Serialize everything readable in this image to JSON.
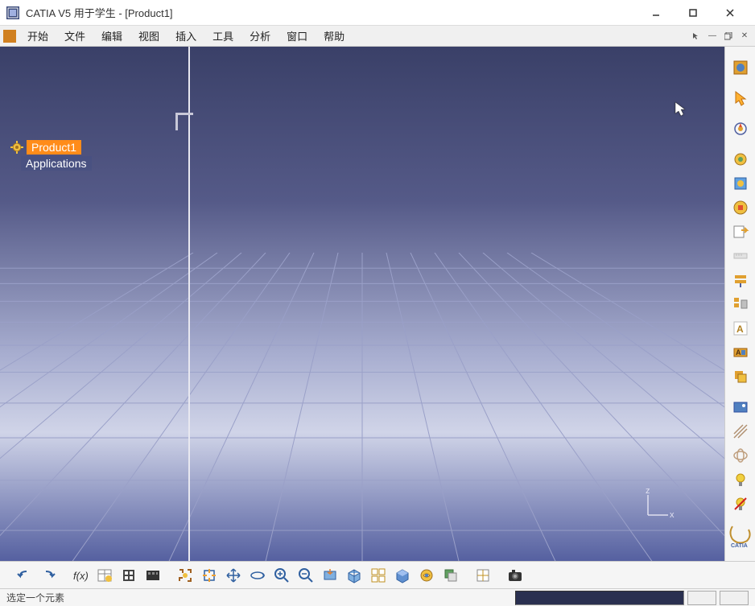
{
  "titlebar": {
    "title": "CATIA V5 用于学生 - [Product1]"
  },
  "menus": {
    "start": "开始",
    "file": "文件",
    "edit": "编辑",
    "view": "视图",
    "insert": "插入",
    "tools": "工具",
    "analyze": "分析",
    "window": "窗口",
    "help": "帮助"
  },
  "tree": {
    "product": "Product1",
    "applications": "Applications"
  },
  "axis": {
    "x": "x",
    "z": "z"
  },
  "status": {
    "prompt": "选定一个元素"
  },
  "right_tools": [
    "workbench-icon",
    "select-arrow-icon",
    "compass-icon",
    "knowledge-icon",
    "properties-icon",
    "feature-icon",
    "export-icon",
    "measure-icon",
    "flatten-icon",
    "tree-icon",
    "text-icon",
    "advanced-icon",
    "stack-icon",
    "render-icon",
    "hatch-icon",
    "view-wire-icon",
    "light-icon",
    "no-light-icon"
  ],
  "bottom_tools": [
    "undo-icon",
    "redo-icon",
    "formula-icon",
    "design-table-icon",
    "knowledge-advisor-icon",
    "scenes-icon",
    "capture-icon",
    "fit-icon",
    "pan-icon",
    "rotate-icon",
    "zoom-in-icon",
    "zoom-out-icon",
    "normal-view-icon",
    "iso-view-icon",
    "multi-view-icon",
    "shading-icon",
    "hide-show-icon",
    "swap-visible-icon",
    "coord-icon",
    "camera-icon"
  ]
}
